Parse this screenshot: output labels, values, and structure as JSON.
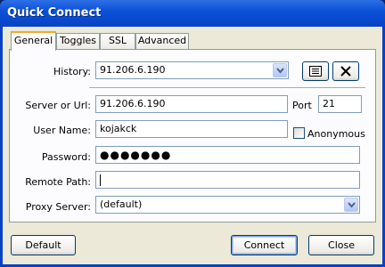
{
  "window": {
    "title": "Quick Connect"
  },
  "tabs": [
    {
      "label": "General",
      "active": true
    },
    {
      "label": "Toggles",
      "active": false
    },
    {
      "label": "SSL",
      "active": false
    },
    {
      "label": "Advanced",
      "active": false
    }
  ],
  "form": {
    "history": {
      "label": "History:",
      "value": "91.206.6.190"
    },
    "server": {
      "label": "Server or Url:",
      "value": "91.206.6.190"
    },
    "port": {
      "label": "Port",
      "value": "21"
    },
    "username": {
      "label": "User Name:",
      "value": "kojakck"
    },
    "anonymous": {
      "label": "Anonymous",
      "checked": false
    },
    "password": {
      "label": "Password:",
      "value": "●●●●●●●"
    },
    "remote_path": {
      "label": "Remote Path:",
      "value": ""
    },
    "proxy": {
      "label": "Proxy Server:",
      "value": "(default)"
    }
  },
  "icons": {
    "bookmarks": "list-icon",
    "clear": "close-icon"
  },
  "buttons": {
    "default": "Default",
    "connect": "Connect",
    "close": "Close"
  },
  "colors": {
    "titlebar": "#0842c4",
    "client": "#ece9d8",
    "tab_highlight": "#f1a92f"
  }
}
